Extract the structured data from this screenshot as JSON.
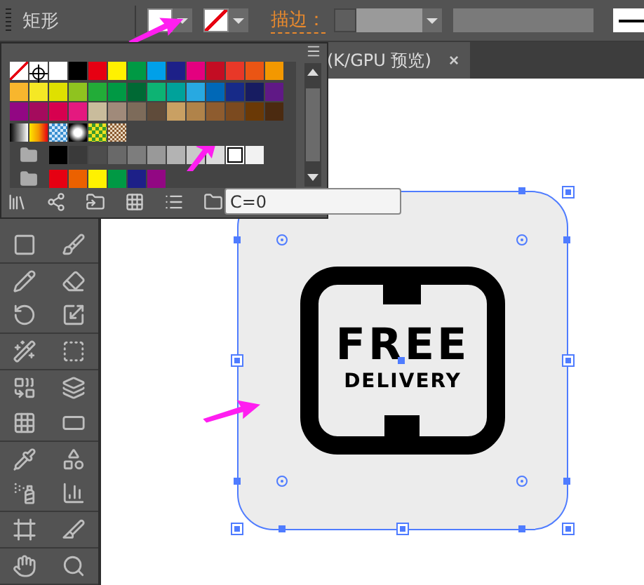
{
  "control_bar": {
    "object_type": "矩形",
    "fill": {
      "color": "#ffffff"
    },
    "stroke": {
      "kind": "none"
    },
    "stroke_label": "描边："
  },
  "document_tab": {
    "title": "(K/GPU 预览)",
    "close": "×"
  },
  "swatches_panel": {
    "rows": [
      {
        "group": false,
        "swatches": [
          {
            "kind": "none",
            "selected": false
          },
          {
            "kind": "registration",
            "selected": false
          },
          {
            "kind": "color",
            "color": "#ffffff",
            "selected": false
          },
          {
            "kind": "color",
            "color": "#000000",
            "selected": false
          },
          {
            "kind": "color",
            "color": "#e60012",
            "selected": false
          },
          {
            "kind": "color",
            "color": "#fff100",
            "selected": false
          },
          {
            "kind": "color",
            "color": "#009944",
            "selected": false
          },
          {
            "kind": "color",
            "color": "#00a0e9",
            "selected": false
          },
          {
            "kind": "color",
            "color": "#1d2088",
            "selected": false
          },
          {
            "kind": "color",
            "color": "#e4007f",
            "selected": false
          },
          {
            "kind": "color",
            "color": "#c30d23",
            "selected": false
          },
          {
            "kind": "color",
            "color": "#e83828",
            "selected": false
          },
          {
            "kind": "color",
            "color": "#ea5514",
            "selected": false
          },
          {
            "kind": "color",
            "color": "#f39800",
            "selected": false
          }
        ]
      },
      {
        "group": false,
        "swatches": [
          {
            "kind": "color",
            "color": "#f8b62d",
            "selected": false
          },
          {
            "kind": "color",
            "color": "#f5e825",
            "selected": false
          },
          {
            "kind": "color",
            "color": "#dfe000",
            "selected": false
          },
          {
            "kind": "color",
            "color": "#8fc31f",
            "selected": false
          },
          {
            "kind": "color",
            "color": "#22ac38",
            "selected": false
          },
          {
            "kind": "color",
            "color": "#009944",
            "selected": false
          },
          {
            "kind": "color",
            "color": "#006934",
            "selected": false
          },
          {
            "kind": "color",
            "color": "#0db373",
            "selected": false
          },
          {
            "kind": "color",
            "color": "#00a29a",
            "selected": false
          },
          {
            "kind": "color",
            "color": "#28a9e1",
            "selected": false
          },
          {
            "kind": "color",
            "color": "#0068b7",
            "selected": false
          },
          {
            "kind": "color",
            "color": "#172a88",
            "selected": false
          },
          {
            "kind": "color",
            "color": "#171c61",
            "selected": false
          },
          {
            "kind": "color",
            "color": "#601986",
            "selected": false
          }
        ]
      },
      {
        "group": false,
        "swatches": [
          {
            "kind": "color",
            "color": "#920783",
            "selected": false
          },
          {
            "kind": "color",
            "color": "#a40b5d",
            "selected": false
          },
          {
            "kind": "color",
            "color": "#d7004f",
            "selected": false
          },
          {
            "kind": "color",
            "color": "#e4197f",
            "selected": false
          },
          {
            "kind": "color",
            "color": "#c9bc9c",
            "selected": false
          },
          {
            "kind": "color",
            "color": "#a08a7a",
            "selected": false
          },
          {
            "kind": "color",
            "color": "#7d6b5a",
            "selected": false
          },
          {
            "kind": "color",
            "color": "#5f4b3a",
            "selected": false
          },
          {
            "kind": "color",
            "color": "#c9a063",
            "selected": false
          },
          {
            "kind": "color",
            "color": "#b0834a",
            "selected": false
          },
          {
            "kind": "color",
            "color": "#8e5c2f",
            "selected": false
          },
          {
            "kind": "color",
            "color": "#7b4a1f",
            "selected": false
          },
          {
            "kind": "color",
            "color": "#6a3906",
            "selected": false
          },
          {
            "kind": "color",
            "color": "#4b2a10",
            "selected": false
          }
        ]
      },
      {
        "group": false,
        "swatches": [
          {
            "kind": "grayramp",
            "selected": false
          },
          {
            "kind": "warmramp",
            "selected": false
          },
          {
            "kind": "checker",
            "selected": false
          },
          {
            "kind": "radial",
            "selected": false
          },
          {
            "kind": "foliage",
            "selected": false
          },
          {
            "kind": "texture",
            "selected": false
          }
        ]
      },
      {
        "group": true,
        "swatches": [
          {
            "kind": "color",
            "color": "#000000",
            "selected": false
          },
          {
            "kind": "color",
            "color": "#3a3a3a",
            "selected": false
          },
          {
            "kind": "color",
            "color": "#4d4d4d",
            "selected": false
          },
          {
            "kind": "color",
            "color": "#696969",
            "selected": false
          },
          {
            "kind": "color",
            "color": "#7d7d7d",
            "selected": false
          },
          {
            "kind": "color",
            "color": "#999999",
            "selected": false
          },
          {
            "kind": "color",
            "color": "#b3b3b3",
            "selected": false
          },
          {
            "kind": "color",
            "color": "#c9c9c9",
            "selected": false
          },
          {
            "kind": "color",
            "color": "#dcdcdc",
            "selected": false
          },
          {
            "kind": "color",
            "color": "#ffffff",
            "selected": true
          },
          {
            "kind": "color",
            "color": "#f2f2f2",
            "selected": false
          }
        ]
      },
      {
        "group": true,
        "swatches": [
          {
            "kind": "color",
            "color": "#e60012",
            "selected": false
          },
          {
            "kind": "color",
            "color": "#eb6100",
            "selected": false
          },
          {
            "kind": "color",
            "color": "#fff100",
            "selected": false
          },
          {
            "kind": "color",
            "color": "#009944",
            "selected": false
          },
          {
            "kind": "color",
            "color": "#1d2088",
            "selected": false
          },
          {
            "kind": "color",
            "color": "#920783",
            "selected": false
          }
        ]
      }
    ],
    "tooltip": "C=0"
  },
  "artwork": {
    "selected": true,
    "title": "FREE",
    "subtitle": "DELIVERY"
  }
}
